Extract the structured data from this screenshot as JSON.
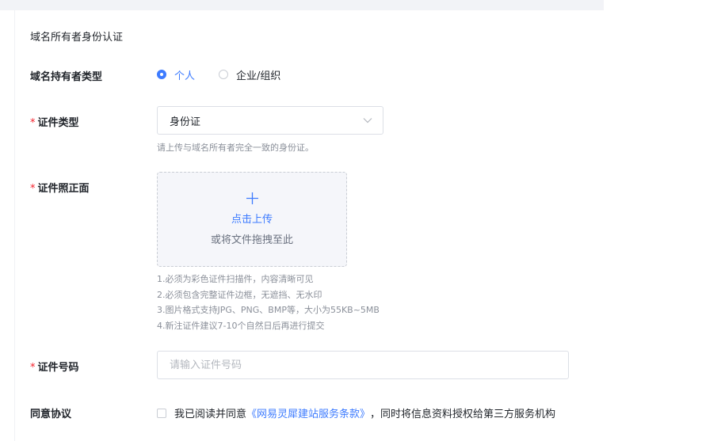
{
  "section": {
    "title": "域名所有者身份认证"
  },
  "holder_type": {
    "label": "域名持有者类型",
    "options": [
      {
        "label": "个人",
        "checked": true
      },
      {
        "label": "企业/组织",
        "checked": false
      }
    ]
  },
  "cert_type": {
    "required_mark": "*",
    "label": "证件类型",
    "value": "身份证",
    "hint": "请上传与域名所有者完全一致的身份证。"
  },
  "cert_front": {
    "required_mark": "*",
    "label": "证件照正面",
    "upload_label": "点击上传",
    "drag_hint": "或将文件拖拽至此",
    "requirements": [
      "1.必须为彩色证件扫描件，内容清晰可见",
      "2.必须包含完整证件边框，无遮挡、无水印",
      "3.图片格式支持JPG、PNG、BMP等，大小为55KB~5MB",
      "4.新注证件建议7-10个自然日后再进行提交"
    ]
  },
  "cert_number": {
    "required_mark": "*",
    "label": "证件号码",
    "placeholder": "请输入证件号码",
    "value": ""
  },
  "agreement": {
    "label": "同意协议",
    "prefix": "我已阅读并同意",
    "link_text": "《网易灵犀建站服务条款》",
    "suffix": "，同时将信息资料授权给第三方服务机构",
    "checked": false
  },
  "colors": {
    "accent": "#3d7bff",
    "required": "#f5222d",
    "text": "#1f2329",
    "muted": "#8a8f99"
  }
}
